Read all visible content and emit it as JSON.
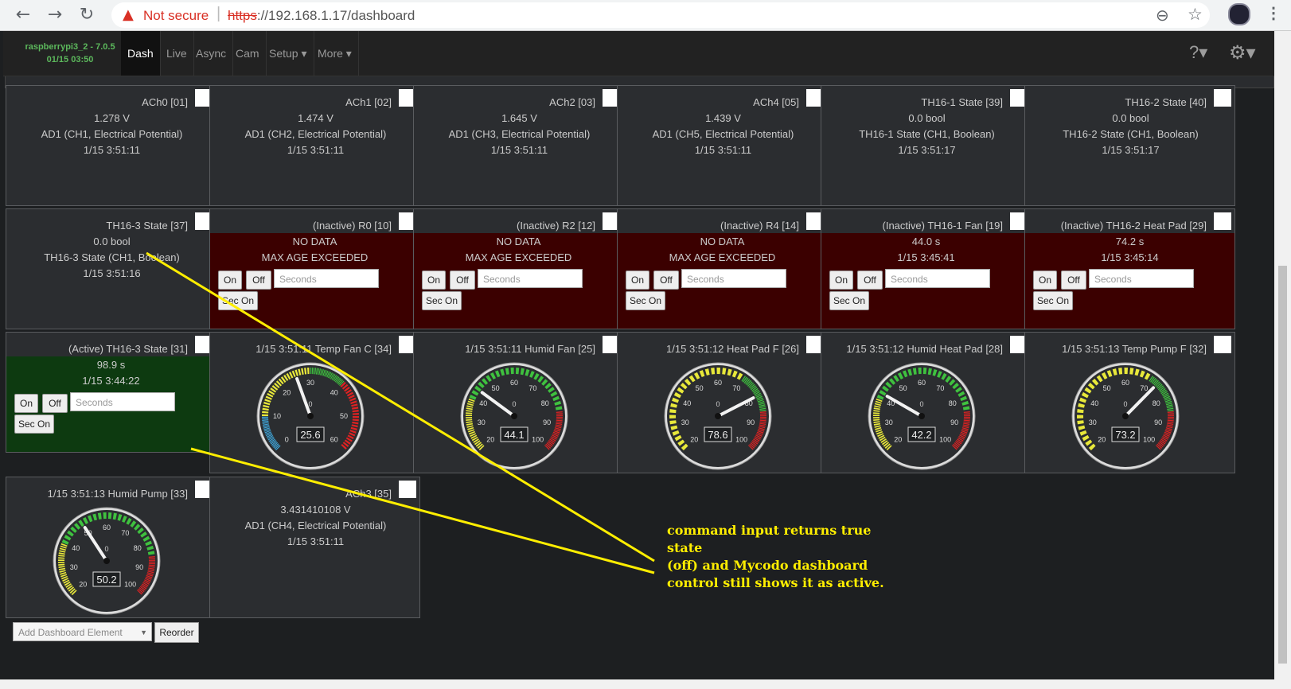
{
  "browser": {
    "not_secure": "Not secure",
    "url_scheme": "https",
    "url_rest": "://192.168.1.17/dashboard",
    "icons": [
      "back-icon",
      "forward-icon",
      "reload-icon",
      "warning-icon",
      "zoom-icon",
      "star-icon",
      "profile-icon",
      "menu-icon"
    ]
  },
  "navbar": {
    "brand_line1": "raspberrypi3_2 - 7.0.5",
    "brand_line2": "01/15 03:50",
    "items": [
      "Dash",
      "Live",
      "Async",
      "Cam",
      "Setup ▾",
      "More ▾"
    ],
    "active": "Dash"
  },
  "inputs_row": [
    {
      "title": "ACh0 [01]",
      "value": "1.278 V",
      "desc": "AD1 (CH1, Electrical Potential)",
      "time": "1/15 3:51:11"
    },
    {
      "title": "ACh1 [02]",
      "value": "1.474 V",
      "desc": "AD1 (CH2, Electrical Potential)",
      "time": "1/15 3:51:11"
    },
    {
      "title": "ACh2 [03]",
      "value": "1.645 V",
      "desc": "AD1 (CH3, Electrical Potential)",
      "time": "1/15 3:51:11"
    },
    {
      "title": "ACh4 [05]",
      "value": "1.439 V",
      "desc": "AD1 (CH5, Electrical Potential)",
      "time": "1/15 3:51:11"
    },
    {
      "title": "TH16-1 State [39]",
      "value": "0.0 bool",
      "desc": "TH16-1 State (CH1, Boolean)",
      "time": "1/15 3:51:17"
    },
    {
      "title": "TH16-2 State [40]",
      "value": "0.0 bool",
      "desc": "TH16-2 State (CH1, Boolean)",
      "time": "1/15 3:51:17"
    }
  ],
  "th16_3_state": {
    "title": "TH16-3 State [37]",
    "value": "0.0 bool",
    "desc": "TH16-3 State (CH1, Boolean)",
    "time": "1/15 3:51:16"
  },
  "outputs": [
    {
      "title": "(Inactive) R0 [10]",
      "line1": "NO DATA",
      "line2": "MAX AGE EXCEEDED",
      "state": "inactive"
    },
    {
      "title": "(Inactive) R2 [12]",
      "line1": "NO DATA",
      "line2": "MAX AGE EXCEEDED",
      "state": "inactive"
    },
    {
      "title": "(Inactive) R4 [14]",
      "line1": "NO DATA",
      "line2": "MAX AGE EXCEEDED",
      "state": "inactive"
    },
    {
      "title": "(Inactive) TH16-1 Fan [19]",
      "line1": "44.0 s",
      "line2": "1/15 3:45:41",
      "state": "inactive"
    },
    {
      "title": "(Inactive) TH16-2 Heat Pad [29]",
      "line1": "74.2 s",
      "line2": "1/15 3:45:14",
      "state": "inactive"
    }
  ],
  "active_output": {
    "title": "(Active) TH16-3 State [31]",
    "line1": "98.9 s",
    "line2": "1/15 3:44:22",
    "state": "active"
  },
  "controls": {
    "on": "On",
    "off": "Off",
    "seconds_placeholder": "Seconds",
    "sec_on": "Sec On"
  },
  "gauges": [
    {
      "title": "1/15 3:51:11 Temp Fan C [34]",
      "value": 25.6,
      "display": "25.6",
      "min": 0,
      "max": 60,
      "ticks": [
        "0",
        "10",
        "20",
        "30",
        "40",
        "50",
        "60"
      ],
      "center": "0",
      "bands": [
        {
          "from": 0,
          "to": 10,
          "color": "#3fa7dc"
        },
        {
          "from": 10,
          "to": 30,
          "color": "#e8e83a"
        },
        {
          "from": 30,
          "to": 40,
          "color": "#3fc13f"
        },
        {
          "from": 40,
          "to": 60,
          "color": "#dd2222"
        }
      ]
    },
    {
      "title": "1/15 3:51:11 Humid Fan [25]",
      "value": 44.1,
      "display": "44.1",
      "min": 20,
      "max": 100,
      "ticks": [
        "20",
        "30",
        "40",
        "50",
        "60",
        "70",
        "80",
        "90",
        "100"
      ],
      "center": "0",
      "bands": [
        {
          "from": 20,
          "to": 40,
          "color": "#e8e83a"
        },
        {
          "from": 40,
          "to": 85,
          "color": "#3fc13f"
        },
        {
          "from": 85,
          "to": 100,
          "color": "#dd2222"
        }
      ]
    },
    {
      "title": "1/15 3:51:12 Heat Pad F [26]",
      "value": 78.6,
      "display": "78.6",
      "min": 20,
      "max": 100,
      "ticks": [
        "20",
        "30",
        "40",
        "50",
        "60",
        "70",
        "80",
        "90",
        "100"
      ],
      "center": "0",
      "bands": [
        {
          "from": 20,
          "to": 70,
          "color": "#e8e83a"
        },
        {
          "from": 70,
          "to": 85,
          "color": "#3fc13f"
        },
        {
          "from": 85,
          "to": 100,
          "color": "#dd2222"
        }
      ]
    },
    {
      "title": "1/15 3:51:12 Humid Heat Pad [28]",
      "value": 42.2,
      "display": "42.2",
      "min": 20,
      "max": 100,
      "ticks": [
        "20",
        "30",
        "40",
        "50",
        "60",
        "70",
        "80",
        "90",
        "100"
      ],
      "center": "0",
      "bands": [
        {
          "from": 20,
          "to": 40,
          "color": "#e8e83a"
        },
        {
          "from": 40,
          "to": 85,
          "color": "#3fc13f"
        },
        {
          "from": 85,
          "to": 100,
          "color": "#dd2222"
        }
      ]
    },
    {
      "title": "1/15 3:51:13 Temp Pump F [32]",
      "value": 73.2,
      "display": "73.2",
      "min": 20,
      "max": 100,
      "ticks": [
        "20",
        "30",
        "40",
        "50",
        "60",
        "70",
        "80",
        "90",
        "100"
      ],
      "center": "0",
      "bands": [
        {
          "from": 20,
          "to": 70,
          "color": "#e8e83a"
        },
        {
          "from": 70,
          "to": 85,
          "color": "#3fc13f"
        },
        {
          "from": 85,
          "to": 100,
          "color": "#dd2222"
        }
      ]
    },
    {
      "title": "1/15 3:51:13 Humid Pump [33]",
      "value": 50.2,
      "display": "50.2",
      "min": 20,
      "max": 100,
      "ticks": [
        "20",
        "30",
        "40",
        "50",
        "60",
        "70",
        "80",
        "90",
        "100"
      ],
      "center": "0",
      "bands": [
        {
          "from": 20,
          "to": 40,
          "color": "#e8e83a"
        },
        {
          "from": 40,
          "to": 85,
          "color": "#3fc13f"
        },
        {
          "from": 85,
          "to": 100,
          "color": "#dd2222"
        }
      ]
    }
  ],
  "ach3": {
    "title": "ACh3 [35]",
    "value": "3.431410108 V",
    "desc": "AD1 (CH4, Electrical Potential)",
    "time": "1/15 3:51:11"
  },
  "bottom": {
    "add_element": "Add Dashboard Element",
    "reorder": "Reorder"
  },
  "annotation": {
    "line1": "command input returns true state",
    "line2": "(off) and Mycodo dashboard",
    "line3": "control still shows it as active.",
    "color": "#ffee00"
  },
  "colors": {
    "inactive_bg": "#3b0000",
    "active_bg": "#0d3a10",
    "brand": "#5cb85c"
  }
}
